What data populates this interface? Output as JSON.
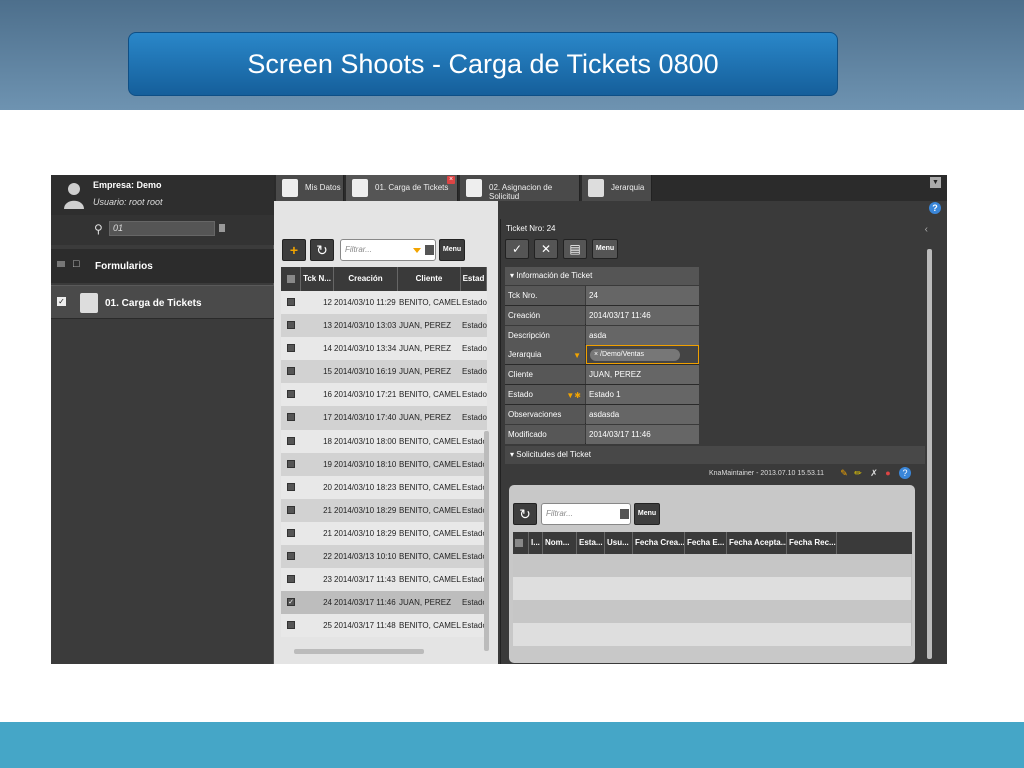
{
  "slide": {
    "title": "Screen Shoots - Carga de Tickets  0800",
    "colors": {
      "header": "#5c809e",
      "title_box": "#1f74b8",
      "footer": "#45a6c7"
    }
  },
  "left_panel": {
    "empresa": "Empresa: Demo",
    "usuario": "Usuario: root root",
    "search_value": "01",
    "section": "Formularios",
    "items": [
      {
        "label": "01. Carga de Tickets",
        "checked": true
      }
    ]
  },
  "tabs": [
    {
      "label": "Mis Datos",
      "icon": "user-icon"
    },
    {
      "label": "01. Carga de Tickets",
      "icon": "user-icon",
      "active": true,
      "closable": true
    },
    {
      "label": "02. Asignacion de Solicitud",
      "icon": "user-icon"
    },
    {
      "label": "Jerarquia",
      "icon": "key-icon"
    }
  ],
  "middle": {
    "filter_placeholder": "Filtrar...",
    "menu_label": "Menu",
    "columns": [
      "Tck N...",
      "Creación",
      "Cliente",
      "Estad"
    ],
    "rows": [
      {
        "n": "12",
        "creacion": "2014/03/10 11:29",
        "cliente": "BENITO, CAMELA",
        "estado": "Estado"
      },
      {
        "n": "13",
        "creacion": "2014/03/10 13:03",
        "cliente": "JUAN, PEREZ",
        "estado": "Estado"
      },
      {
        "n": "14",
        "creacion": "2014/03/10 13:34",
        "cliente": "JUAN, PEREZ",
        "estado": "Estado"
      },
      {
        "n": "15",
        "creacion": "2014/03/10 16:19",
        "cliente": "JUAN, PEREZ",
        "estado": "Estado"
      },
      {
        "n": "16",
        "creacion": "2014/03/10 17:21",
        "cliente": "BENITO, CAMELA",
        "estado": "Estado"
      },
      {
        "n": "17",
        "creacion": "2014/03/10 17:40",
        "cliente": "JUAN, PEREZ",
        "estado": "Estado"
      },
      {
        "n": "18",
        "creacion": "2014/03/10 18:00",
        "cliente": "BENITO, CAMELA",
        "estado": "Estado"
      },
      {
        "n": "19",
        "creacion": "2014/03/10 18:10",
        "cliente": "BENITO, CAMELA",
        "estado": "Estado"
      },
      {
        "n": "20",
        "creacion": "2014/03/10 18:23",
        "cliente": "BENITO, CAMELA",
        "estado": "Estado"
      },
      {
        "n": "21",
        "creacion": "2014/03/10 18:29",
        "cliente": "BENITO, CAMELA",
        "estado": "Estado"
      },
      {
        "n": "21",
        "creacion": "2014/03/10 18:29",
        "cliente": "BENITO, CAMELA",
        "estado": "Estado"
      },
      {
        "n": "22",
        "creacion": "2014/03/13 10:10",
        "cliente": "BENITO, CAMELA",
        "estado": "Estado"
      },
      {
        "n": "23",
        "creacion": "2014/03/17 11:43",
        "cliente": "BENITO, CAMELA",
        "estado": "Estado"
      },
      {
        "n": "24",
        "creacion": "2014/03/17 11:46",
        "cliente": "JUAN, PEREZ",
        "estado": "Estado",
        "checked": true
      },
      {
        "n": "25",
        "creacion": "2014/03/17 11:48",
        "cliente": "BENITO, CAMELA",
        "estado": "Estado"
      }
    ]
  },
  "detail": {
    "ticket_nro": "Ticket Nro: 24",
    "menu_label": "Menu",
    "info_title": "Información de Ticket",
    "fields": [
      {
        "label": "Tck Nro.",
        "value": "24"
      },
      {
        "label": "Creación",
        "value": "2014/03/17 11:46"
      },
      {
        "label": "Descripción",
        "value": "asda"
      },
      {
        "label": "Jerarquia",
        "value": "/Demo/Ventas",
        "tag": true
      },
      {
        "label": "Cliente",
        "value": "JUAN, PEREZ"
      },
      {
        "label": "Estado",
        "value": "Estado 1"
      },
      {
        "label": "Observaciones",
        "value": "asdasda"
      },
      {
        "label": "Modificado",
        "value": "2014/03/17 11:46"
      }
    ],
    "solicitudes_title": "Solicitudes del Ticket",
    "kna_text": "KnaMaintainer - 2013.07.10 15.53.11",
    "sub_filter_placeholder": "Filtrar...",
    "sub_menu_label": "Menu",
    "sub_columns": [
      "I...",
      "Nom...",
      "Esta...",
      "Usu...",
      "Fecha Crea...",
      "Fecha E...",
      "Fecha Acepta...",
      "Fecha Rec..."
    ]
  }
}
